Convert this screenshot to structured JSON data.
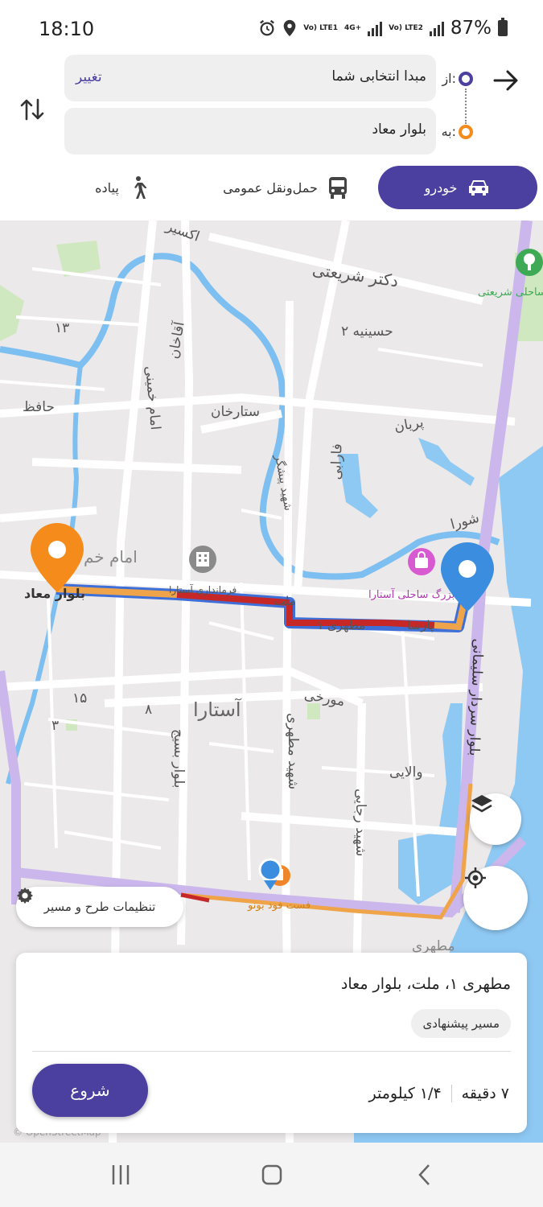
{
  "status": {
    "time": "18:10",
    "net1": "Vo) LTE1",
    "net_mid": "4G+",
    "net2": "Vo) LTE2",
    "battery": "87%"
  },
  "route": {
    "from_label": "از:",
    "from_value": "مبدا انتخابی شما",
    "change_label": "تغییر",
    "to_label": "به:",
    "to_value": "بلوار معاد"
  },
  "modes": {
    "car": "خودرو",
    "transit": "حمل‌ونقل عمومی",
    "walk": "پیاده"
  },
  "map": {
    "labels": {
      "dr_shariati": "دکتر شریعتی",
      "hosseinieh": "حسینیه ۲",
      "sattarkhan": "ستارخان",
      "parian": "پریان",
      "hafez": "حافظ",
      "imam_khomeini": "امام خمینی",
      "aghakhan": "آقاخان",
      "shahid_pishgar": "شهید پیشگر",
      "farabi": "فارابی",
      "shoura": "شورا",
      "imam_kh": "امام خم",
      "farmandari": "فرمانداری آستارا",
      "mellat": "ملت",
      "motahari1": "مطهری ۱",
      "parsa": "پارسا",
      "store": "بزرگ ساحلی آستارا",
      "bolvar_maad": "بلوار معاد",
      "astara": "آستارا",
      "mourkhi": "مورخی",
      "valaei": "والایی",
      "shahid_motahari": "شهید مطهری",
      "bolvar_basij": "بلوار بسیج",
      "shahid_rajaei": "شهید رجایی",
      "bolvar_soleimani": "بلوار سردار سلیمانی",
      "fastfood": "فست فود بونو",
      "motahari_s": "مطهری",
      "n15": "۱۵",
      "n8": "۸",
      "n3": "۳",
      "n13": "۱۳",
      "aksir": "اکسیر",
      "park": "ساحلی شریعتی"
    },
    "settings_chip": "تنظیمات طرح و مسیر",
    "credit": "© OpenStreetMap"
  },
  "sheet": {
    "route_title": "مطهری ۱، ملت، بلوار معاد",
    "badge": "مسیر پیشنهادی",
    "duration": "۷ دقیقه",
    "distance": "۱/۴ کیلومتر",
    "start": "شروع"
  },
  "colors": {
    "brand": "#4b3f9f",
    "destination": "#f48b1b",
    "origin_pin": "#3b8de0",
    "traffic_heavy": "#c62828",
    "traffic_medium": "#f0a44a",
    "route_blue": "#3e6fd8"
  },
  "icons": {
    "back": "arrow-right-icon",
    "swap": "swap-vertical-icon",
    "car": "car-icon",
    "bus": "bus-icon",
    "walk": "walking-icon",
    "layers": "layers-icon",
    "locate": "crosshair-icon",
    "settings": "gear-icon"
  }
}
